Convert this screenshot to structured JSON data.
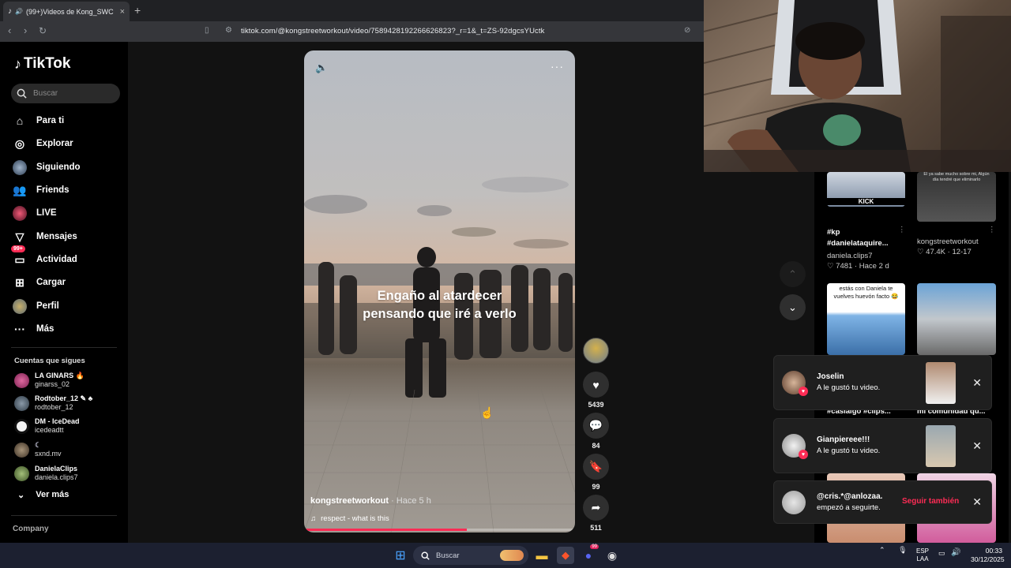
{
  "browser": {
    "tab_title": "(99+)Videos de Kong_SWC",
    "url": "tiktok.com/@kongstreetworkout/video/7589428192266626823?_r=1&_t=ZS-92dgcsYUctk"
  },
  "sidebar": {
    "logo": "TikTok",
    "search_placeholder": "Buscar",
    "nav": [
      {
        "label": "Para ti",
        "icon": "home-icon"
      },
      {
        "label": "Explorar",
        "icon": "compass-icon"
      },
      {
        "label": "Siguiendo",
        "icon": "following-avatar-icon"
      },
      {
        "label": "Friends",
        "icon": "friends-icon"
      },
      {
        "label": "LIVE",
        "icon": "live-icon"
      },
      {
        "label": "Mensajes",
        "icon": "messages-icon"
      },
      {
        "label": "Actividad",
        "icon": "activity-icon",
        "badge": "99+"
      },
      {
        "label": "Cargar",
        "icon": "upload-icon"
      },
      {
        "label": "Perfil",
        "icon": "profile-avatar-icon"
      },
      {
        "label": "Más",
        "icon": "more-icon"
      }
    ],
    "following_title": "Cuentas que sigues",
    "following": [
      {
        "name": "LA GINARS",
        "handle": "ginarss_02",
        "color": "#c33a7a"
      },
      {
        "name": "Rodtober_12",
        "handle": "rodtober_12",
        "color": "#5a6b7a"
      },
      {
        "name": "DM - IceDead",
        "handle": "icedeadtt",
        "color": "#f0f0f0"
      },
      {
        "name": "",
        "handle": "sxnd.mv",
        "color": "#7a6a55"
      },
      {
        "name": "DanielaClips",
        "handle": "daniela.clips7",
        "color": "#7d9a5a"
      }
    ],
    "see_more": "Ver más",
    "company": "Company"
  },
  "video": {
    "caption_line1": "Engaño al atardecer",
    "caption_line2": "pensando que iré a verlo",
    "author": "kongstreetworkout",
    "time": "· Hace 5 h",
    "music": "respect - what is this",
    "progress": 0.6
  },
  "actions": {
    "likes": "5439",
    "comments": "84",
    "saves": "99",
    "shares": "511"
  },
  "grid": {
    "items": [
      {
        "title": "#kp #danielataquire...",
        "author": "daniela.clips7",
        "likes": "7481",
        "time": "Hace 2 d",
        "thumb_text": "KICK"
      },
      {
        "author": "kongstreetworkout",
        "likes": "47.4K",
        "time": "12-17",
        "thumb_text": "El ya sabe mucho sobre mi, Algún día tendré que eliminarlo"
      },
      {
        "thumb_text": "estás con Daniela te vuelves huevón facto 😂",
        "title": "#caslaigo #clips..."
      },
      {
        "title": "mi comunidad qu..."
      }
    ]
  },
  "notifications": [
    {
      "name": "Joselin",
      "text": "A le gustó tu video."
    },
    {
      "name": "Gianpiereee!!!",
      "text": "A le gustó tu video."
    },
    {
      "name": "@cris.*@anlozaa.",
      "text": "empezó a seguirte.",
      "action": "Seguir también"
    }
  ],
  "taskbar": {
    "search": "Buscar",
    "lang1": "ESP",
    "lang2": "LAA",
    "time": "00:33",
    "date": "30/12/2025",
    "discord_badge": "99"
  }
}
